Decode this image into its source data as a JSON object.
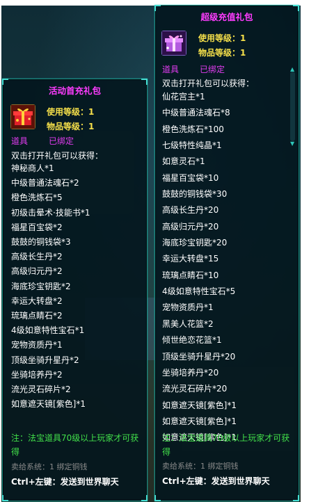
{
  "left_panel": {
    "title": "活动首充礼包",
    "use_level_label": "使用等级：",
    "use_level_value": "1",
    "item_level_label": "物品等级：",
    "item_level_value": "1",
    "category": "道具",
    "bound": "已绑定",
    "open_hint": "双击打开礼包可以获得：",
    "items": [
      "神秘商人*1",
      "中级普通法魂石*2",
      "橙色洗炼石*5",
      "初级击晕术·技能书*1",
      "福星百宝袋*2",
      "鼓鼓的铜钱袋*3",
      "高级长生丹*2",
      "高级归元丹*2",
      "海底珍宝钥匙*2",
      "幸运大转盘*2",
      "琉璃点睛石*2",
      "4级如意特性宝石*1",
      "宠物资质丹*1",
      "顶级坐骑升星丹*2",
      "坐骑培养丹*2",
      "流光灵石碎片*2",
      "如意遮天镜[紫色]*1"
    ],
    "note": "注：法宝道具70级以上玩家才可获得",
    "sell": "卖给系统：1 绑定铜钱",
    "hotkey": "Ctrl+左键：发送到世界聊天"
  },
  "right_panel": {
    "title": "超级充值礼包",
    "use_level_label": "使用等级：",
    "use_level_value": "1",
    "item_level_label": "物品等级：",
    "item_level_value": "1",
    "category": "道具",
    "bound": "已绑定",
    "open_hint": "双击打开礼包可以获得：",
    "items": [
      "仙花宫主*1",
      "中级普通法魂石*8",
      "橙色洗炼石*100",
      "七级特性纯晶*1",
      "如意灵石*1",
      "福星百宝袋*10",
      "鼓鼓的铜钱袋*30",
      "高级长生丹*20",
      "高级归元丹*20",
      "海底珍宝钥匙*20",
      "幸运大转盘*15",
      "琉璃点睛石*10",
      "4级如意特性宝石*5",
      "宠物资质丹*1",
      "黑美人花篮*2",
      "倾世绝恋花篮*1",
      "顶级坐骑升星丹*20",
      "坐骑培养丹*20",
      "流光灵石碎片*20",
      "如意遮天镜[紫色]*1",
      "如意遮天镜[紫色]*1",
      "如意遮天镜[紫色]*1"
    ],
    "note": "注：法宝道具70级以上玩家才可获得",
    "sell": "卖给系统：1 绑定铜钱",
    "hotkey": "Ctrl+左键：发送到世界聊天"
  },
  "colors": {
    "title": "#ff3cff",
    "level": "#f6e04a",
    "bound": "#e23cf0",
    "note": "#42e04a",
    "border": "#1b8e86"
  },
  "icons": {
    "left_gift": "red-gift-box-icon",
    "right_gift": "purple-gift-box-icon"
  }
}
